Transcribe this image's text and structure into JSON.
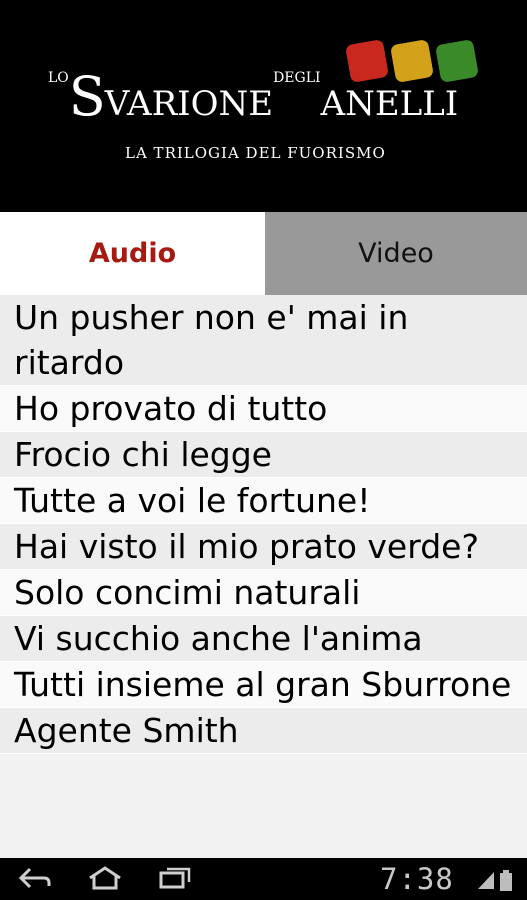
{
  "header": {
    "logo_words": {
      "lo": "LO",
      "s": "S",
      "varione": "VARIONE",
      "degli": "DEGLI",
      "anelli": "ANELLI"
    },
    "subtitle": "LA TRILOGIA DEL FUORISMO",
    "dice_colors": [
      "#c8281e",
      "#d4a21a",
      "#3a8a2a"
    ]
  },
  "tabs": [
    {
      "label": "Audio",
      "selected": true
    },
    {
      "label": "Video",
      "selected": false
    }
  ],
  "items": [
    "Un pusher non e' mai in ritardo",
    "Ho provato di tutto",
    "Frocio chi legge",
    "Tutte a voi le fortune!",
    "Hai visto il mio prato verde?",
    "Solo concimi naturali",
    "Vi succhio anche l'anima",
    "Tutti insieme al gran Sburrone",
    "Agente Smith"
  ],
  "statusbar": {
    "time": "7:38",
    "icons": [
      "back-icon",
      "home-icon",
      "recent-apps-icon",
      "signal-icon",
      "battery-icon"
    ]
  },
  "colors": {
    "accent": "#a51b12",
    "header_bg": "#000000",
    "tab_inactive": "#999999"
  }
}
